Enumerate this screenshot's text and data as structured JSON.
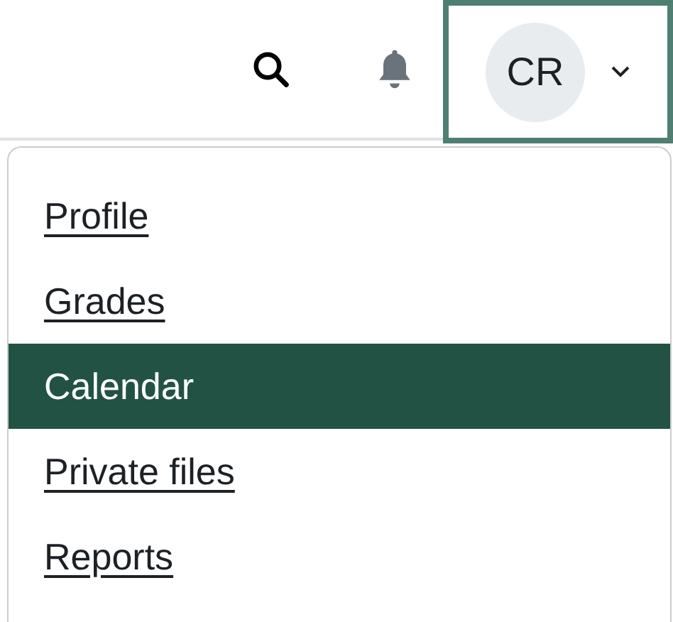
{
  "header": {
    "user_menu": {
      "initials": "CR",
      "expanded": true
    }
  },
  "menu": {
    "items": [
      {
        "label": "Profile",
        "selected": false
      },
      {
        "label": "Grades",
        "selected": false
      },
      {
        "label": "Calendar",
        "selected": true
      },
      {
        "label": "Private files",
        "selected": false
      },
      {
        "label": "Reports",
        "selected": false
      }
    ]
  }
}
